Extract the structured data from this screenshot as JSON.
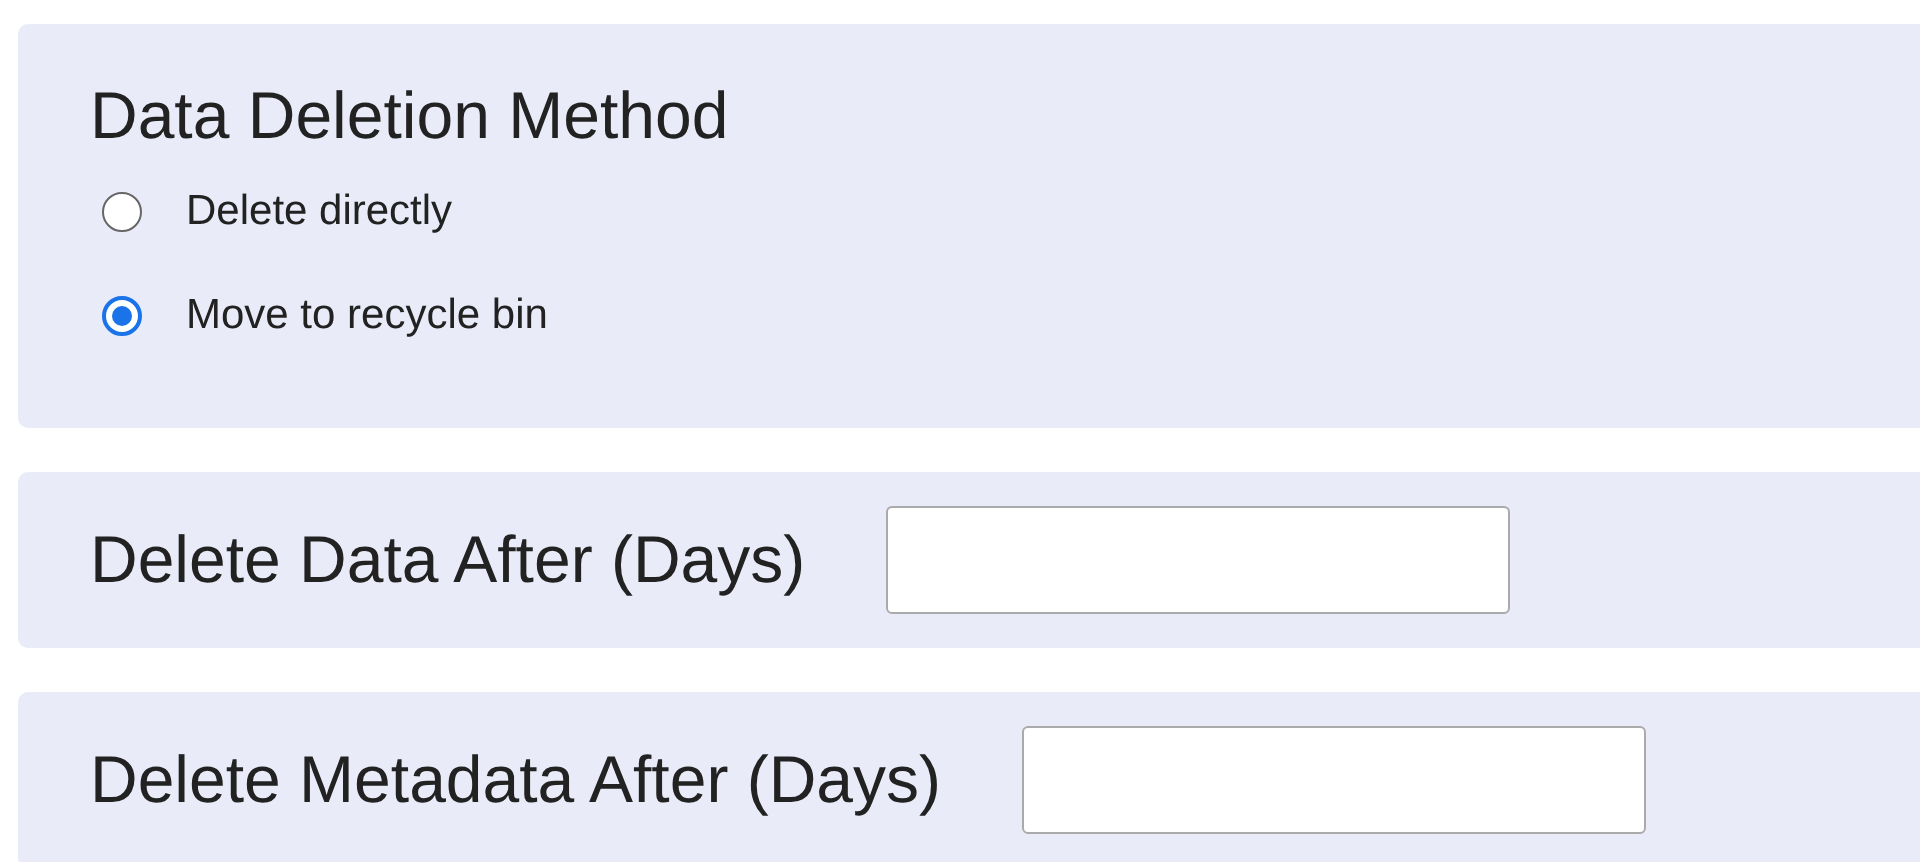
{
  "deletion_method": {
    "title": "Data Deletion Method",
    "options": [
      {
        "label": "Delete directly",
        "selected": false
      },
      {
        "label": "Move to recycle bin",
        "selected": true
      }
    ]
  },
  "fields": [
    {
      "label": "Delete Data After (Days)"
    },
    {
      "label": "Delete Metadata After (Days)"
    }
  ]
}
